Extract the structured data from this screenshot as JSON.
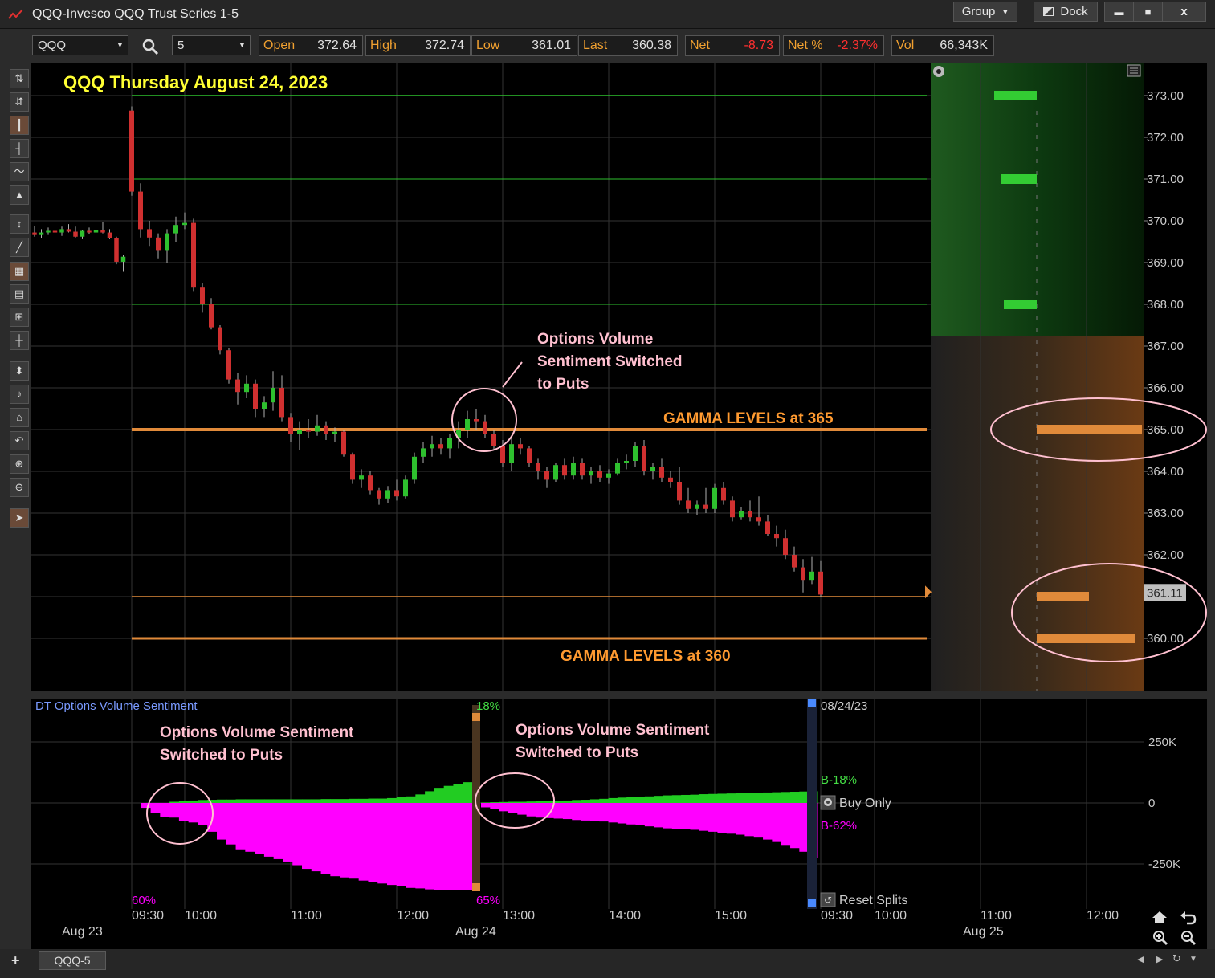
{
  "window": {
    "title": "QQQ-Invesco QQQ Trust Series 1-5",
    "group_label": "Group",
    "dock_label": "Dock",
    "minimize_glyph": "▬",
    "maximize_glyph": "■",
    "close_glyph": "x"
  },
  "toolbar": {
    "symbol": "QQQ",
    "interval": "5",
    "quotes": [
      {
        "label": "Open",
        "value": "372.64",
        "negative": false
      },
      {
        "label": "High",
        "value": "372.74",
        "negative": false
      },
      {
        "label": "Low",
        "value": "361.01",
        "negative": false
      },
      {
        "label": "Last",
        "value": "360.38",
        "negative": false
      },
      {
        "label": "Net",
        "value": "-8.73",
        "negative": true
      },
      {
        "label": "Net %",
        "value": "-2.37%",
        "negative": true
      },
      {
        "label": "Vol",
        "value": "66,343K",
        "negative": false
      }
    ]
  },
  "chart": {
    "title": "QQQ Thursday August 24, 2023",
    "price_ticks": [
      "373.00",
      "372.00",
      "371.00",
      "370.00",
      "369.00",
      "368.00",
      "367.00",
      "366.00",
      "365.00",
      "364.00",
      "363.00",
      "362.00",
      "361.00",
      "360.00"
    ],
    "last_price_tag": "361.11",
    "annotations": {
      "sentiment_note": [
        "Options Volume",
        "Sentiment Switched",
        "to Puts"
      ],
      "gamma_365": "GAMMA LEVELS at 365",
      "gamma_360": "GAMMA LEVELS at 360"
    },
    "colors": {
      "background": "#000000",
      "up_candle": "#2ec02e",
      "down_candle": "#d03030",
      "gamma_orange": "#e08a3a",
      "green_line": "#2ec02e",
      "title_yellow": "#ffff33",
      "annotation_pink": "#ffc0d0",
      "annotation_orange": "#ff9a30",
      "put_magenta": "#ff00ff",
      "call_green": "#22cc22"
    },
    "chart_data": {
      "type": "candlestick",
      "title": "QQQ Thursday August 24, 2023",
      "ylim": [
        359.3,
        373.8
      ],
      "x_ticks_time": [
        "09:30",
        "10:00",
        "11:00",
        "12:00",
        "13:00",
        "14:00",
        "15:00",
        "09:30",
        "10:00",
        "11:00",
        "12:00"
      ],
      "x_ticks_date": [
        "Aug 23",
        "Aug 24",
        "Aug 25"
      ],
      "green_levels": [
        373.0,
        371.0,
        368.0
      ],
      "gamma_levels": [
        365.0,
        361.0,
        360.0
      ],
      "candles_prev_day": [
        [
          369.72,
          369.88,
          369.62,
          369.66
        ],
        [
          369.66,
          369.8,
          369.58,
          369.72
        ],
        [
          369.72,
          369.84,
          369.66,
          369.76
        ],
        [
          369.76,
          369.9,
          369.7,
          369.72
        ],
        [
          369.72,
          369.86,
          369.64,
          369.8
        ],
        [
          369.8,
          369.92,
          369.72,
          369.74
        ],
        [
          369.74,
          369.86,
          369.6,
          369.62
        ],
        [
          369.62,
          369.78,
          369.56,
          369.76
        ],
        [
          369.76,
          369.84,
          369.68,
          369.72
        ],
        [
          369.72,
          369.82,
          369.64,
          369.78
        ],
        [
          369.78,
          369.98,
          369.7,
          369.72
        ],
        [
          369.72,
          369.8,
          369.56,
          369.58
        ],
        [
          369.58,
          369.62,
          368.96,
          369.02
        ],
        [
          369.02,
          369.18,
          368.78,
          369.14
        ]
      ],
      "candles": [
        [
          372.64,
          372.74,
          370.6,
          370.7
        ],
        [
          370.7,
          370.9,
          369.6,
          369.8
        ],
        [
          369.8,
          370.0,
          369.4,
          369.6
        ],
        [
          369.6,
          369.7,
          369.1,
          369.3
        ],
        [
          369.3,
          369.8,
          369.0,
          369.7
        ],
        [
          369.7,
          370.1,
          369.5,
          369.9
        ],
        [
          369.9,
          370.2,
          369.8,
          369.95
        ],
        [
          369.95,
          370.05,
          368.3,
          368.4
        ],
        [
          368.4,
          368.5,
          367.8,
          368.0
        ],
        [
          368.0,
          368.15,
          367.4,
          367.45
        ],
        [
          367.45,
          367.5,
          366.8,
          366.9
        ],
        [
          366.9,
          366.95,
          366.1,
          366.2
        ],
        [
          366.2,
          366.35,
          365.6,
          365.9
        ],
        [
          365.9,
          366.3,
          365.75,
          366.1
        ],
        [
          366.1,
          366.2,
          365.3,
          365.5
        ],
        [
          365.5,
          365.8,
          365.3,
          365.65
        ],
        [
          365.65,
          366.4,
          365.45,
          366.0
        ],
        [
          366.0,
          366.3,
          365.2,
          365.3
        ],
        [
          365.3,
          365.4,
          364.7,
          364.9
        ],
        [
          364.9,
          365.2,
          364.5,
          365.0
        ],
        [
          365.0,
          365.25,
          364.8,
          364.95
        ],
        [
          364.95,
          365.35,
          364.85,
          365.1
        ],
        [
          365.1,
          365.2,
          364.75,
          364.9
        ],
        [
          364.9,
          365.05,
          364.7,
          364.95
        ],
        [
          364.95,
          365.0,
          364.35,
          364.4
        ],
        [
          364.4,
          364.45,
          363.7,
          363.8
        ],
        [
          363.8,
          364.05,
          363.6,
          363.9
        ],
        [
          363.9,
          364.0,
          363.45,
          363.55
        ],
        [
          363.55,
          363.6,
          363.2,
          363.35
        ],
        [
          363.35,
          363.65,
          363.25,
          363.55
        ],
        [
          363.55,
          363.8,
          363.3,
          363.4
        ],
        [
          363.4,
          363.9,
          363.35,
          363.8
        ],
        [
          363.8,
          364.45,
          363.7,
          364.35
        ],
        [
          364.35,
          364.7,
          364.2,
          364.55
        ],
        [
          364.55,
          364.85,
          364.35,
          364.65
        ],
        [
          364.65,
          364.8,
          364.4,
          364.55
        ],
        [
          364.55,
          364.9,
          364.3,
          364.8
        ],
        [
          364.8,
          365.2,
          364.55,
          365.0
        ],
        [
          365.0,
          365.45,
          364.8,
          365.25
        ],
        [
          365.25,
          365.5,
          365.0,
          365.2
        ],
        [
          365.2,
          365.35,
          364.8,
          364.9
        ],
        [
          364.9,
          365.0,
          364.5,
          364.6
        ],
        [
          364.6,
          364.75,
          364.1,
          364.2
        ],
        [
          364.2,
          364.8,
          364.0,
          364.65
        ],
        [
          364.65,
          364.8,
          364.4,
          364.55
        ],
        [
          364.55,
          364.6,
          364.1,
          364.2
        ],
        [
          364.2,
          364.3,
          363.8,
          364.0
        ],
        [
          364.0,
          364.1,
          363.6,
          363.8
        ],
        [
          363.8,
          364.2,
          363.75,
          364.15
        ],
        [
          364.15,
          364.3,
          363.8,
          363.9
        ],
        [
          363.9,
          364.35,
          363.8,
          364.2
        ],
        [
          364.2,
          364.3,
          363.8,
          363.9
        ],
        [
          363.9,
          364.1,
          363.7,
          364.0
        ],
        [
          364.0,
          364.15,
          363.75,
          363.85
        ],
        [
          363.85,
          364.05,
          363.7,
          363.95
        ],
        [
          363.95,
          364.3,
          363.9,
          364.2
        ],
        [
          364.2,
          364.4,
          364.05,
          364.25
        ],
        [
          364.25,
          364.7,
          364.1,
          364.6
        ],
        [
          364.6,
          364.75,
          363.9,
          364.0
        ],
        [
          364.0,
          364.2,
          363.8,
          364.1
        ],
        [
          364.1,
          364.3,
          363.75,
          363.85
        ],
        [
          363.85,
          364.0,
          363.6,
          363.75
        ],
        [
          363.75,
          364.1,
          363.2,
          363.3
        ],
        [
          363.3,
          363.6,
          363.0,
          363.1
        ],
        [
          363.1,
          363.3,
          362.95,
          363.2
        ],
        [
          363.2,
          363.6,
          363.0,
          363.1
        ],
        [
          363.1,
          363.7,
          363.0,
          363.6
        ],
        [
          363.6,
          363.75,
          363.2,
          363.3
        ],
        [
          363.3,
          363.4,
          362.8,
          362.9
        ],
        [
          362.9,
          363.15,
          362.85,
          363.05
        ],
        [
          363.05,
          363.3,
          362.8,
          362.9
        ],
        [
          362.9,
          363.4,
          362.7,
          362.8
        ],
        [
          362.8,
          362.95,
          362.45,
          362.5
        ],
        [
          362.5,
          362.7,
          362.2,
          362.4
        ],
        [
          362.4,
          362.6,
          361.9,
          362.0
        ],
        [
          362.0,
          362.2,
          361.6,
          361.7
        ],
        [
          361.7,
          361.9,
          361.1,
          361.4
        ],
        [
          361.4,
          361.95,
          361.3,
          361.6
        ],
        [
          361.6,
          361.85,
          361.0,
          361.05
        ]
      ]
    }
  },
  "sentiment": {
    "panel_title": "DT Options Volume Sentiment",
    "scale_ticks": [
      "250K",
      "0",
      "-250K"
    ],
    "pct_top": "18%",
    "pct_bottom_left": "60%",
    "pct_bottom_mid": "65%",
    "date_label": "08/24/23",
    "b_green": "B-18%",
    "b_magenta": "B-62%",
    "buy_only_label": "Buy Only",
    "reset_splits_label": "Reset Splits",
    "note_left": [
      "Options Volume Sentiment",
      "Switched to Puts"
    ],
    "note_right": [
      "Options Volume Sentiment",
      "Switched to Puts"
    ],
    "chart_data": {
      "type": "area",
      "ylim": [
        -360,
        420
      ],
      "calls_first": [
        0,
        0,
        0,
        0,
        5,
        8,
        10,
        12,
        13,
        14,
        14,
        15,
        15,
        15,
        15,
        15,
        15,
        15,
        15,
        15,
        16,
        16,
        16,
        17,
        17,
        18,
        18,
        20,
        23,
        27,
        35,
        48,
        62,
        70,
        76,
        85
      ],
      "puts_first": [
        0,
        -20,
        -40,
        -58,
        -60,
        -75,
        -80,
        -90,
        -118,
        -150,
        -170,
        -190,
        -200,
        -210,
        -220,
        -230,
        -240,
        -255,
        -270,
        -280,
        -290,
        -300,
        -305,
        -310,
        -318,
        -324,
        -330,
        -336,
        -342,
        -348,
        -350,
        -354,
        -356,
        -356,
        -356,
        -356
      ],
      "calls_second": [
        2,
        3,
        4,
        5,
        5,
        6,
        7,
        8,
        9,
        10,
        12,
        13,
        15,
        17,
        20,
        22,
        24,
        25,
        27,
        29,
        31,
        32,
        33,
        34,
        36,
        37,
        38,
        39,
        40,
        41,
        42,
        43,
        44,
        45,
        46,
        47,
        48
      ],
      "puts_second": [
        -18,
        -26,
        -34,
        -40,
        -48,
        -55,
        -60,
        -62,
        -64,
        -66,
        -70,
        -72,
        -74,
        -76,
        -80,
        -84,
        -88,
        -92,
        -96,
        -100,
        -104,
        -106,
        -108,
        -110,
        -114,
        -118,
        -122,
        -126,
        -130,
        -136,
        -142,
        -150,
        -160,
        -172,
        -185,
        -200,
        -225
      ]
    }
  },
  "bottom": {
    "tab_label": "QQQ-5",
    "add_glyph": "+"
  }
}
